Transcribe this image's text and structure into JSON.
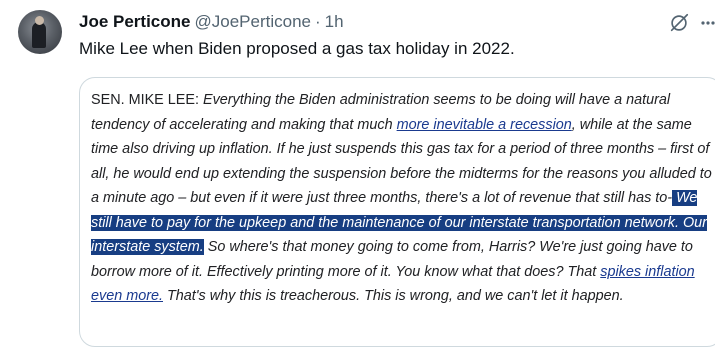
{
  "author": {
    "name": "Joe Perticone",
    "handle": "@JoePerticone",
    "separator": "·",
    "time": "1h"
  },
  "icons": {
    "avatar": "avatar",
    "grok": "grok-icon",
    "more": "more-icon"
  },
  "tweet": {
    "text": "Mike Lee when Biden proposed a gas tax holiday in 2022."
  },
  "quote": {
    "speaker": "SEN. MIKE LEE:",
    "p1": " Everything the Biden administration seems to be doing will have a natural tendency of accelerating and making that much ",
    "link1": "more inevitable a recession",
    "p2": ", while at the same time also driving up inflation. If he just suspends this gas tax for a period of three months – first of all, he would end up extending the suspension before the midterms for the reasons you alluded to a minute ago – but even if it were just three months, there's a lot of revenue that still has to-",
    "highlight": " We still have to pay for the upkeep and the maintenance of our interstate transportation network. Our interstate system.",
    "p3": " So where's that money going to come from, Harris? We're just going have to borrow more of it. Effectively printing more of it. You know what that does? That ",
    "link2": "spikes inflation even more.",
    "p4": " That's why this is treacherous. This is wrong, and we can't let it happen."
  },
  "colors": {
    "highlight_bg": "#173e82",
    "link": "#1a3a8f",
    "muted": "#536471"
  }
}
